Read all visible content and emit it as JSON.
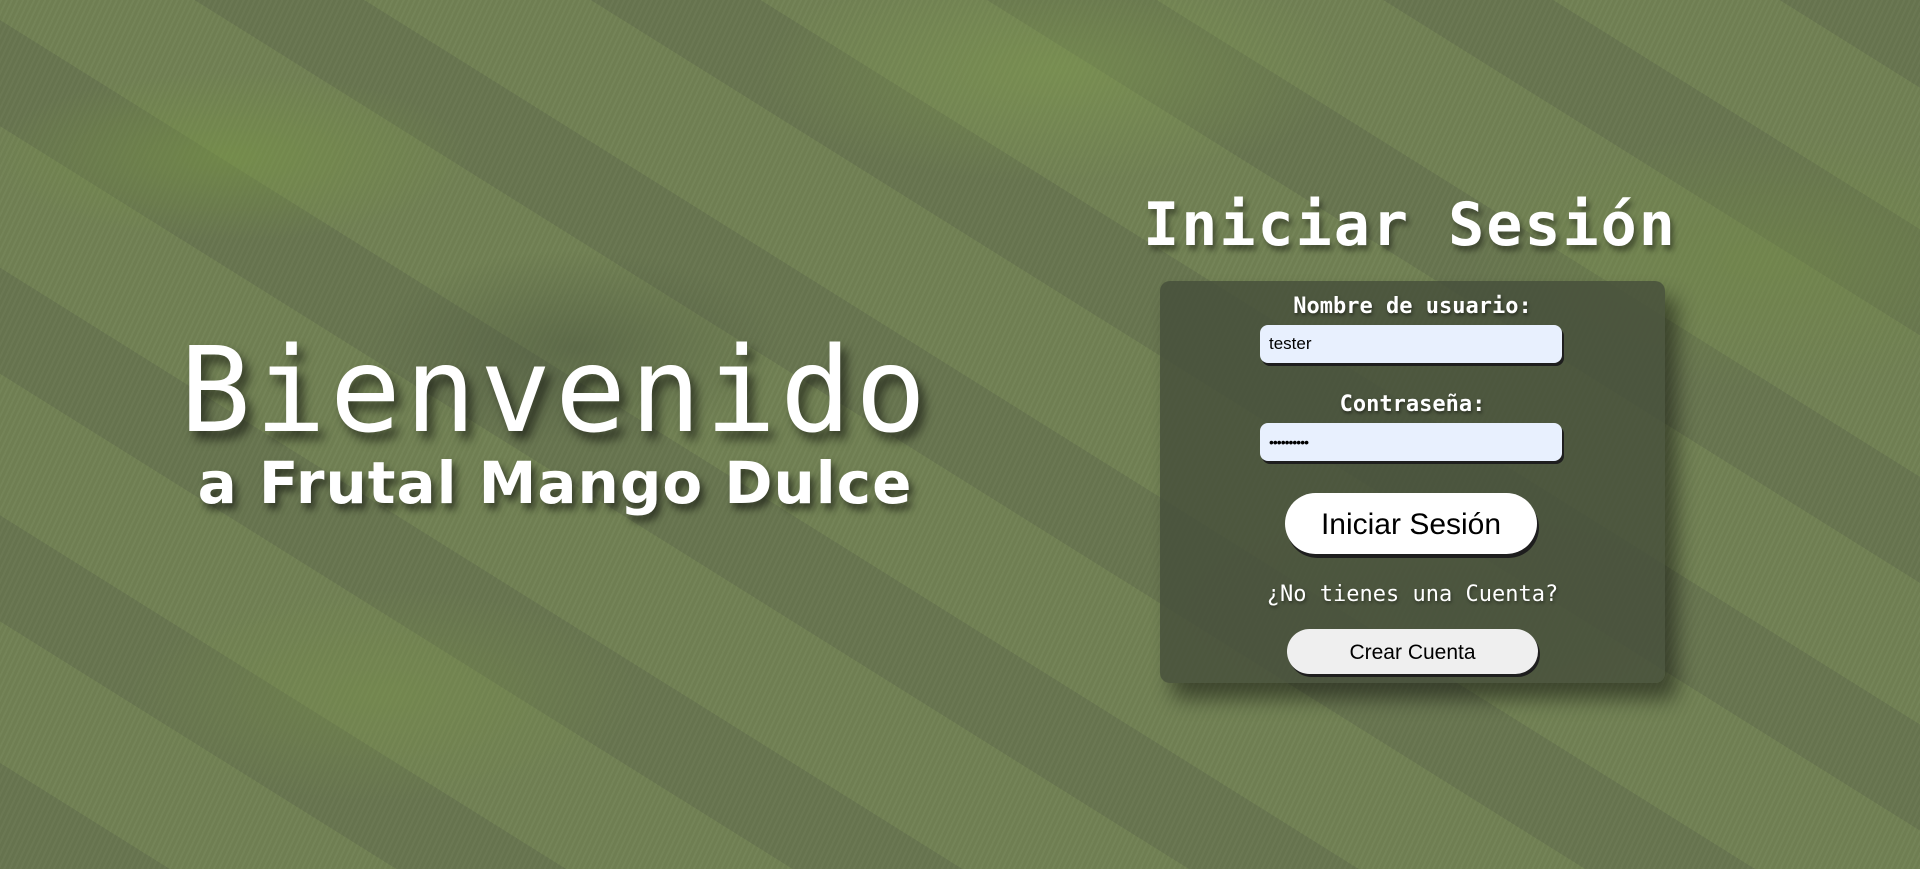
{
  "welcome": {
    "title": "Bienvenido",
    "subtitle": "a Frutal Mango Dulce"
  },
  "login": {
    "title": "Iniciar Sesión",
    "username_label": "Nombre de usuario:",
    "username_value": "tester",
    "password_label": "Contraseña:",
    "password_value": "••••••••••",
    "submit_label": "Iniciar Sesión",
    "no_account_text": "¿No tienes una Cuenta?",
    "create_account_label": "Crear Cuenta"
  },
  "colors": {
    "background": "#6d7a55",
    "card": "#464e3a",
    "input_fill": "#e8f0fe",
    "text": "#ffffff"
  }
}
